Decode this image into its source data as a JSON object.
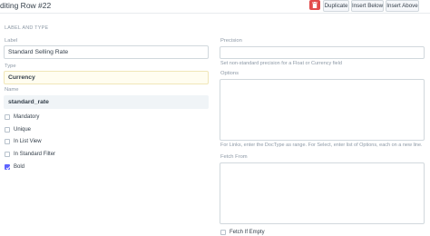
{
  "header": {
    "title": "diting Row #22",
    "buttons": {
      "duplicate": "Duplicate",
      "insert_below": "Insert Below",
      "insert_above": "Insert Above"
    },
    "delete_icon": "trash-icon"
  },
  "section": {
    "label": "LABEL AND TYPE"
  },
  "left": {
    "label": {
      "caption": "Label",
      "value": "Standard Selling Rate"
    },
    "type": {
      "caption": "Type",
      "value": "Currency"
    },
    "name": {
      "caption": "Name",
      "value": "standard_rate"
    },
    "checks": [
      {
        "label": "Mandatory",
        "checked": false
      },
      {
        "label": "Unique",
        "checked": false
      },
      {
        "label": "In List View",
        "checked": false
      },
      {
        "label": "In Standard Filter",
        "checked": false
      },
      {
        "label": "Bold",
        "checked": true
      }
    ]
  },
  "right": {
    "precision": {
      "caption": "Precision",
      "help": "Set non-standard precision for a Float or Currency field"
    },
    "options": {
      "caption": "Options",
      "help": "For Links, enter the DocType as range. For Select, enter list of Options, each on a new line."
    },
    "fetch_from": {
      "caption": "Fetch From"
    },
    "fetch_if_empty": {
      "label": "Fetch If Empty",
      "checked": false
    }
  },
  "colors": {
    "accent": "#5e64ff",
    "danger": "#e24c4c"
  }
}
